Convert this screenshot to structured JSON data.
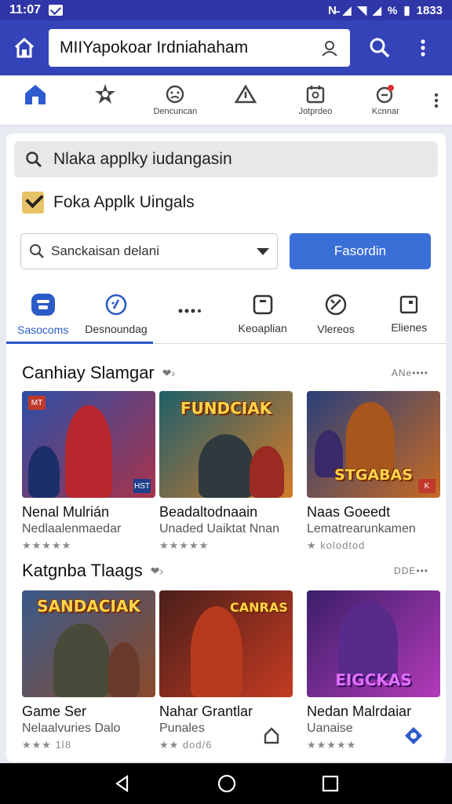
{
  "status_bar": {
    "time": "11:07",
    "battery": "1833"
  },
  "app_bar": {
    "address": "MIIYapokoar Irdniahaham"
  },
  "top_nav": {
    "items": [
      {
        "label": "",
        "icon": "home-icon"
      },
      {
        "label": "",
        "icon": "star-gear-icon"
      },
      {
        "label": "Dencuncan",
        "icon": "face-icon"
      },
      {
        "label": "",
        "icon": "triangle-icon"
      },
      {
        "label": "Jotprdeo",
        "icon": "calendar-icon"
      },
      {
        "label": "Kcnnar",
        "icon": "notification-icon"
      }
    ]
  },
  "search": {
    "text": "Nlaka applky iudangasin"
  },
  "checkbox": {
    "label": "Foka Applk Uingals",
    "checked": true
  },
  "select": {
    "value": "Sanckaisan delani"
  },
  "primary_button": {
    "label": "Fasordin"
  },
  "tabs": [
    {
      "label": "Sasocoms",
      "icon": "app-icon",
      "active": true
    },
    {
      "label": "Desnoundag",
      "icon": "compass-icon"
    },
    {
      "label": "",
      "icon": "dots-icon"
    },
    {
      "label": "Keoaplian",
      "icon": "frame-icon"
    },
    {
      "label": "Vlereos",
      "icon": "sword-icon"
    },
    {
      "label": "Elienes",
      "icon": "window-icon"
    }
  ],
  "sections": [
    {
      "title": "Canhiay Slamgar",
      "more": "ANe••••",
      "games": [
        {
          "title": "Nenal Mulrián",
          "subtitle": "Nedlaalenmaedar",
          "rating": "★★★★★",
          "banner": "",
          "badge": "HST",
          "colors": [
            "#2b4fa8",
            "#a8334a"
          ]
        },
        {
          "title": "Beadaltodnaain",
          "subtitle": "Unaded Uaiktat Nnan",
          "rating": "★★★★★",
          "banner": "FUNDCIAK",
          "badge": "",
          "colors": [
            "#1f5f6a",
            "#d47b2a"
          ]
        },
        {
          "title": "Naas Goeedt",
          "subtitle": "Lematrearunkamen",
          "rating": "★ kolodtod",
          "banner": "STGABAS",
          "badge": "K",
          "colors": [
            "#2a3f7a",
            "#c76a22"
          ]
        }
      ]
    },
    {
      "title": "Katgnba Tlaags",
      "more": "DDE•••",
      "games": [
        {
          "title": "Game Ser",
          "subtitle": "Nelaalvuries Dalo",
          "rating": "★★★ 1l8",
          "banner": "SANDACIAK",
          "badge": "",
          "colors": [
            "#3a5a8a",
            "#8a4a2a"
          ]
        },
        {
          "title": "Nahar Grantlar",
          "subtitle": "Punales",
          "rating": "★★ dod/6",
          "banner": "CANRAS",
          "badge": "",
          "colors": [
            "#4a1f1a",
            "#c43b22"
          ]
        },
        {
          "title": "Nedan Malrdaiar",
          "subtitle": "Uanaise",
          "rating": "★★★★★",
          "banner": "EIGCKAS",
          "badge": "",
          "colors": [
            "#3b1f6a",
            "#b33ab8"
          ]
        }
      ]
    }
  ]
}
